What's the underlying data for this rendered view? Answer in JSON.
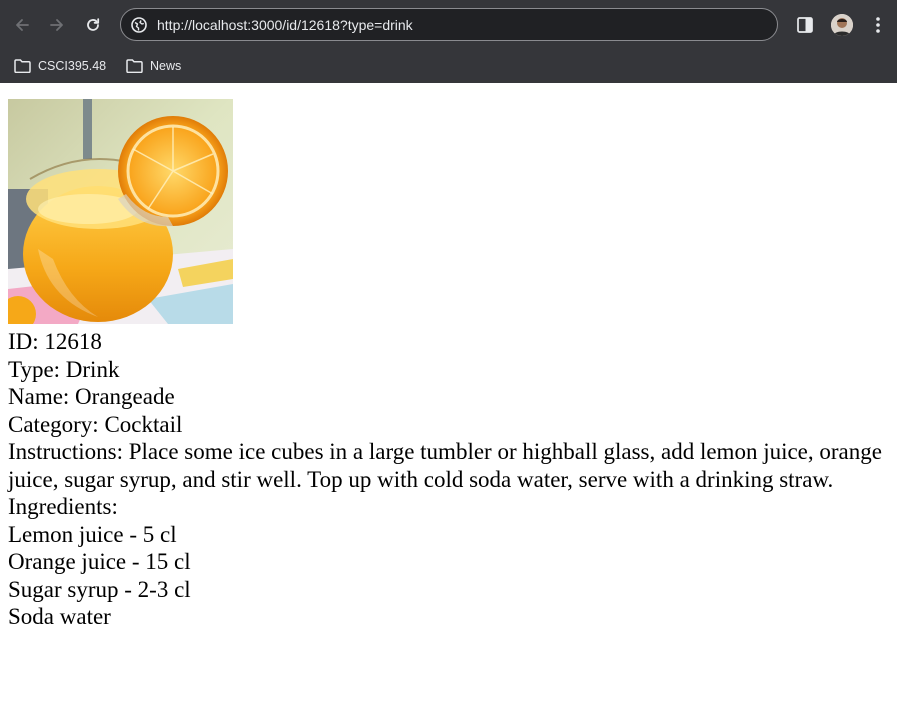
{
  "browser": {
    "url": "http://localhost:3000/id/12618?type=drink",
    "bookmarks": [
      {
        "label": "CSCI395.48",
        "icon": "folder-icon"
      },
      {
        "label": "News",
        "icon": "folder-icon"
      }
    ]
  },
  "drink": {
    "id_line": "ID: 12618",
    "type_line": "Type: Drink",
    "name_line": "Name: Orangeade",
    "category_line": "Category: Cocktail",
    "instructions_line": "Instructions: Place some ice cubes in a large tumbler or highball glass, add lemon juice, orange juice, sugar syrup, and stir well. Top up with cold soda water, serve with a drinking straw.",
    "ingredients_heading": "Ingredients:",
    "ingredients": [
      "Lemon juice - 5 cl",
      "Orange juice - 15 cl",
      "Sugar syrup - 2-3 cl",
      "Soda water"
    ]
  },
  "colors": {
    "chrome_bg": "#35363a",
    "omnibox_bg": "#202124",
    "chrome_text": "#e8eaed",
    "page_bg": "#ffffff"
  }
}
